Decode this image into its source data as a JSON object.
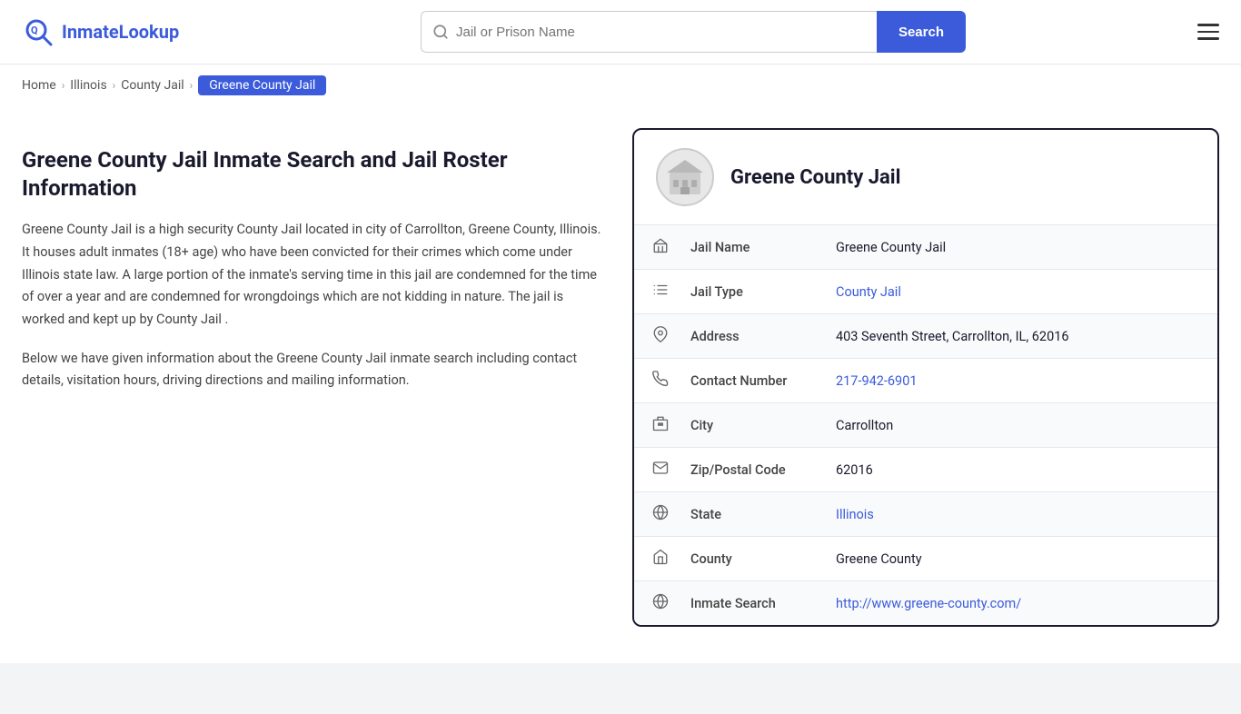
{
  "header": {
    "logo_text_1": "Inmate",
    "logo_text_2": "Lookup",
    "search_placeholder": "Jail or Prison Name",
    "search_button_label": "Search"
  },
  "breadcrumb": {
    "items": [
      {
        "label": "Home",
        "href": "#"
      },
      {
        "label": "Illinois",
        "href": "#"
      },
      {
        "label": "County Jail",
        "href": "#"
      },
      {
        "label": "Greene County Jail",
        "active": true
      }
    ]
  },
  "main": {
    "page_title": "Greene County Jail Inmate Search and Jail Roster Information",
    "desc1": "Greene County Jail is a high security County Jail located in city of Carrollton, Greene County, Illinois. It houses adult inmates (18+ age) who have been convicted for their crimes which come under Illinois state law. A large portion of the inmate's serving time in this jail are condemned for the time of over a year and are condemned for wrongdoings which are not kidding in nature. The jail is worked and kept up by County Jail .",
    "desc2": "Below we have given information about the Greene County Jail inmate search including contact details, visitation hours, driving directions and mailing information."
  },
  "jail_card": {
    "title": "Greene County Jail",
    "fields": [
      {
        "icon": "jail-icon",
        "label": "Jail Name",
        "value": "Greene County Jail",
        "link": null
      },
      {
        "icon": "list-icon",
        "label": "Jail Type",
        "value": "County Jail",
        "link": "#"
      },
      {
        "icon": "location-icon",
        "label": "Address",
        "value": "403 Seventh Street, Carrollton, IL, 62016",
        "link": null
      },
      {
        "icon": "phone-icon",
        "label": "Contact Number",
        "value": "217-942-6901",
        "link": "tel:217-942-6901"
      },
      {
        "icon": "city-icon",
        "label": "City",
        "value": "Carrollton",
        "link": null
      },
      {
        "icon": "mail-icon",
        "label": "Zip/Postal Code",
        "value": "62016",
        "link": null
      },
      {
        "icon": "globe-icon",
        "label": "State",
        "value": "Illinois",
        "link": "#"
      },
      {
        "icon": "county-icon",
        "label": "County",
        "value": "Greene County",
        "link": null
      },
      {
        "icon": "web-icon",
        "label": "Inmate Search",
        "value": "http://www.greene-county.com/",
        "link": "http://www.greene-county.com/"
      }
    ]
  }
}
